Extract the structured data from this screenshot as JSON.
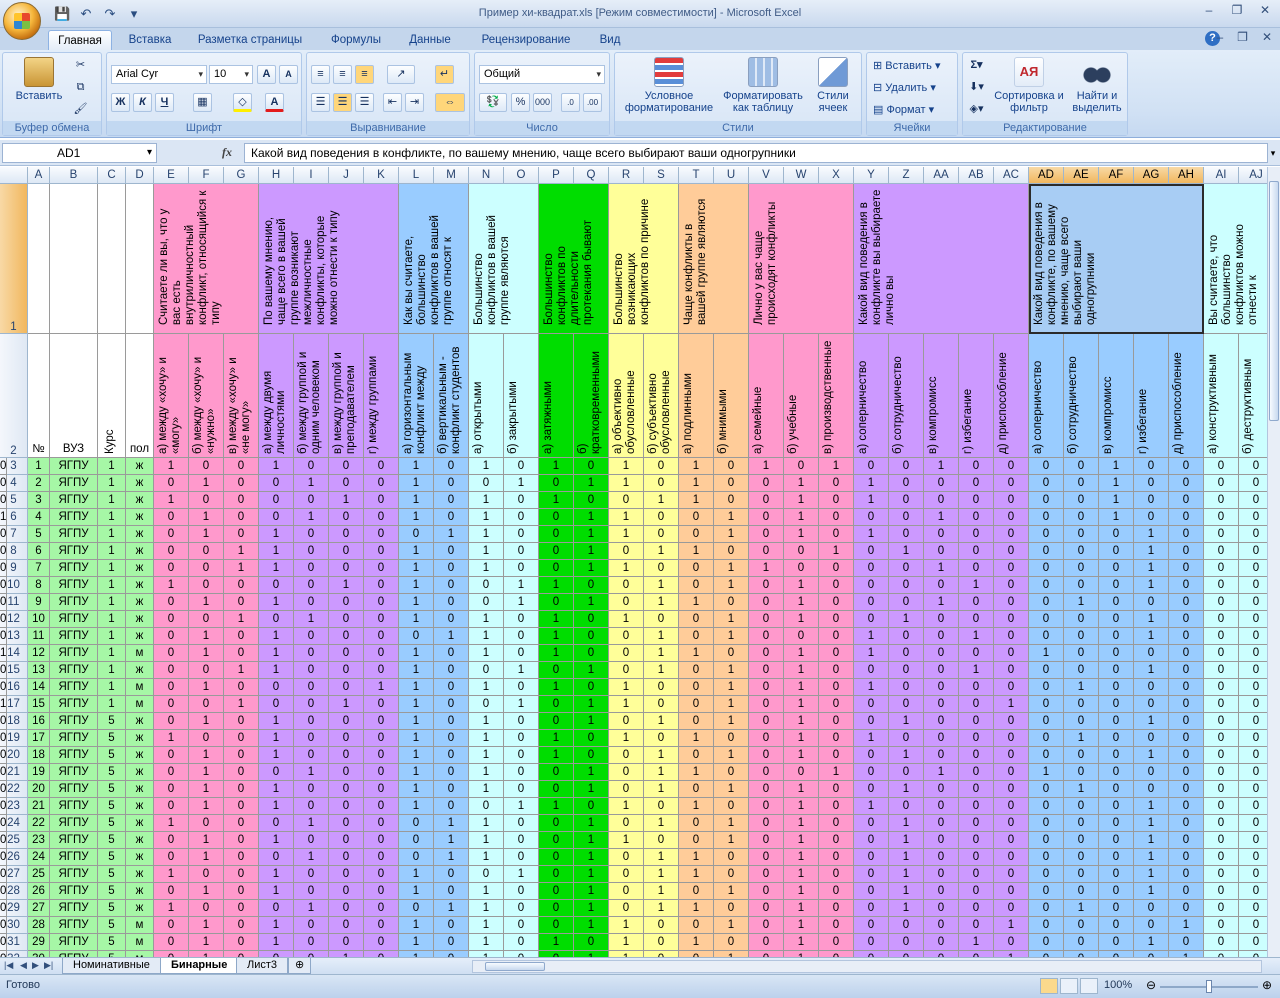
{
  "window": {
    "title": "Пример хи-квадрат.xls  [Режим совместимости] - Microsoft Excel"
  },
  "tabs": [
    "Главная",
    "Вставка",
    "Разметка страницы",
    "Формулы",
    "Данные",
    "Рецензирование",
    "Вид"
  ],
  "ribbon": {
    "clipboard": {
      "label": "Буфер обмена",
      "paste": "Вставить"
    },
    "font": {
      "label": "Шрифт",
      "name": "Arial Cyr",
      "size": "10"
    },
    "alignment": {
      "label": "Выравнивание"
    },
    "number": {
      "label": "Число",
      "format": "Общий"
    },
    "styles": {
      "label": "Стили",
      "cond": "Условное форматирование",
      "table": "Форматировать как таблицу",
      "cell": "Стили ячеек"
    },
    "cells": {
      "label": "Ячейки",
      "insert": "Вставить",
      "delete": "Удалить",
      "format": "Формат"
    },
    "editing": {
      "label": "Редактирование",
      "sort": "Сортировка и фильтр",
      "find": "Найти и выделить"
    }
  },
  "formula_bar": {
    "name_box": "AD1",
    "fx": "fx",
    "content": "Какой вид поведения в конфликте, по вашему мнению, чаще всего выбирают ваши одногрупники"
  },
  "columns": [
    "A",
    "B",
    "C",
    "D",
    "E",
    "F",
    "G",
    "H",
    "I",
    "J",
    "K",
    "L",
    "M",
    "N",
    "O",
    "P",
    "Q",
    "R",
    "S",
    "T",
    "U",
    "V",
    "W",
    "X",
    "Y",
    "Z",
    "AA",
    "AB",
    "AC",
    "AD",
    "AE",
    "AF",
    "AG",
    "AH",
    "AI",
    "AJ"
  ],
  "group_headers": [
    {
      "text": "Считаете ли вы, что у вас есть внутриличностный конфликт, относящийся к типу"
    },
    {
      "text": "По вашему мнению, чаще всего в вашей группе возникают межличностные конфликты, которые можно отнести к типу"
    },
    {
      "text": "Как вы считаете, большинство конфликтов в вашей группе относят к"
    },
    {
      "text": "Большинство конфликтов в вашей группе являются"
    },
    {
      "text": "Большинство конфликтов по длительности протекания бывают"
    },
    {
      "text": "Большинство возникающих конфликтов по причине"
    },
    {
      "text": "Чаще конфликты в вашей группе являются"
    },
    {
      "text": "Лично у вас чаще происходят конфликты"
    },
    {
      "text": "Какой вид поведения в конфликте вы выбираете лично вы"
    },
    {
      "text": "Какой вид поведения в конфликте, по вашему мнению, чаще всего выбирают ваши одногрупники"
    },
    {
      "text": "Вы считаете, что большинство конфликтов можно отнести к"
    }
  ],
  "subheaders_row2": {
    "A": "№",
    "B": "ВУЗ",
    "C": "Курс",
    "D": "пол",
    "E": "а) между «хочу» и «могу»",
    "F": "б) между «хочу» и «нужно»",
    "G": "в) между «хочу» и «не могу»",
    "H": "а) между двумя личностями",
    "I": "б) между группой и одним человеком",
    "J": "в) между группой и преподавателем",
    "K": "г) между группами",
    "L": "а) горизонтальным конфликт между",
    "M": "б) вертикальным - конфликт студентов",
    "N": "а) открытыми",
    "O": "б) закрытыми",
    "P": "а) затяжными",
    "Q": "б) кратковременными",
    "R": "а) объективно обусловленные",
    "S": "б) субъективно обусловленные",
    "T": "а) подлинными",
    "U": "б) мнимыми",
    "V": "а) семейные",
    "W": "б) учебные",
    "X": "в) производственные",
    "Y": "а) соперничество",
    "Z": "б) сотрудничество",
    "AA": "в) компромисс",
    "AB": "г) избегание",
    "AC": "д) приспособление",
    "AD": "а) соперничество",
    "AE": "б) сотрудничество",
    "AF": "в) компромисс",
    "AG": "г) избегание",
    "AH": "д) приспособление",
    "AI": "а) конструктивным",
    "AJ": "б) деструктивным"
  },
  "rows": [
    {
      "n": 1,
      "vuz": "ЯГПУ",
      "kurs": 1,
      "pol": "ж",
      "v": [
        1,
        0,
        0,
        1,
        0,
        0,
        0,
        1,
        0,
        1,
        0,
        1,
        0,
        1,
        0,
        1,
        0,
        1,
        0,
        1,
        0,
        0,
        1,
        0,
        0,
        0,
        0,
        1,
        0,
        0,
        0,
        0,
        1,
        0
      ]
    },
    {
      "n": 2,
      "vuz": "ЯГПУ",
      "kurs": 1,
      "pol": "ж",
      "v": [
        0,
        1,
        0,
        0,
        1,
        0,
        0,
        1,
        0,
        0,
        1,
        0,
        1,
        1,
        0,
        1,
        0,
        0,
        1,
        0,
        1,
        0,
        0,
        0,
        0,
        0,
        0,
        1,
        0,
        0,
        0,
        0,
        1,
        0
      ]
    },
    {
      "n": 3,
      "vuz": "ЯГПУ",
      "kurs": 1,
      "pol": "ж",
      "v": [
        1,
        0,
        0,
        0,
        0,
        1,
        0,
        1,
        0,
        1,
        0,
        1,
        0,
        0,
        1,
        1,
        0,
        0,
        1,
        0,
        1,
        0,
        0,
        0,
        0,
        0,
        0,
        1,
        0,
        0,
        0,
        0,
        1,
        0
      ]
    },
    {
      "n": 4,
      "vuz": "ЯГПУ",
      "kurs": 1,
      "pol": "ж",
      "v": [
        0,
        1,
        0,
        0,
        1,
        0,
        0,
        1,
        0,
        1,
        0,
        0,
        1,
        1,
        0,
        0,
        1,
        0,
        1,
        0,
        0,
        0,
        1,
        0,
        0,
        0,
        0,
        1,
        0,
        0,
        0,
        0,
        0,
        1
      ]
    },
    {
      "n": 5,
      "vuz": "ЯГПУ",
      "kurs": 1,
      "pol": "ж",
      "v": [
        0,
        1,
        0,
        1,
        0,
        0,
        0,
        0,
        1,
        1,
        0,
        0,
        1,
        1,
        0,
        0,
        1,
        0,
        1,
        0,
        1,
        0,
        0,
        0,
        0,
        0,
        0,
        0,
        1,
        0,
        0,
        0,
        1,
        0
      ]
    },
    {
      "n": 6,
      "vuz": "ЯГПУ",
      "kurs": 1,
      "pol": "ж",
      "v": [
        0,
        0,
        1,
        1,
        0,
        0,
        0,
        1,
        0,
        1,
        0,
        0,
        1,
        0,
        1,
        1,
        0,
        0,
        0,
        1,
        0,
        1,
        0,
        0,
        0,
        0,
        0,
        0,
        1,
        0,
        0,
        0,
        1,
        0
      ]
    },
    {
      "n": 7,
      "vuz": "ЯГПУ",
      "kurs": 1,
      "pol": "ж",
      "v": [
        0,
        0,
        1,
        1,
        0,
        0,
        0,
        1,
        0,
        1,
        0,
        0,
        1,
        1,
        0,
        0,
        1,
        1,
        0,
        0,
        0,
        0,
        1,
        0,
        0,
        0,
        0,
        0,
        1,
        0,
        0,
        0,
        1,
        0
      ]
    },
    {
      "n": 8,
      "vuz": "ЯГПУ",
      "kurs": 1,
      "pol": "ж",
      "v": [
        1,
        0,
        0,
        0,
        0,
        1,
        0,
        1,
        0,
        0,
        1,
        1,
        0,
        0,
        1,
        0,
        1,
        0,
        1,
        0,
        0,
        0,
        0,
        1,
        0,
        0,
        0,
        0,
        1,
        0,
        0,
        0,
        1,
        0
      ]
    },
    {
      "n": 9,
      "vuz": "ЯГПУ",
      "kurs": 1,
      "pol": "ж",
      "v": [
        0,
        1,
        0,
        1,
        0,
        0,
        0,
        1,
        0,
        0,
        1,
        0,
        1,
        0,
        1,
        1,
        0,
        0,
        1,
        0,
        0,
        0,
        1,
        0,
        0,
        0,
        1,
        0,
        0,
        0,
        0,
        0,
        1,
        0
      ]
    },
    {
      "n": 10,
      "vuz": "ЯГПУ",
      "kurs": 1,
      "pol": "ж",
      "v": [
        0,
        0,
        1,
        0,
        1,
        0,
        0,
        1,
        0,
        1,
        0,
        1,
        0,
        1,
        0,
        0,
        1,
        0,
        1,
        0,
        0,
        1,
        0,
        0,
        0,
        0,
        0,
        0,
        1,
        0,
        0,
        0,
        1,
        0
      ]
    },
    {
      "n": 11,
      "vuz": "ЯГПУ",
      "kurs": 1,
      "pol": "ж",
      "v": [
        0,
        1,
        0,
        1,
        0,
        0,
        0,
        0,
        1,
        1,
        0,
        1,
        0,
        0,
        1,
        0,
        1,
        0,
        0,
        0,
        1,
        0,
        0,
        1,
        0,
        0,
        0,
        0,
        1,
        0,
        0,
        0,
        1,
        0
      ]
    },
    {
      "n": 12,
      "vuz": "ЯГПУ",
      "kurs": 1,
      "pol": "м",
      "v": [
        0,
        1,
        0,
        1,
        0,
        0,
        0,
        1,
        0,
        1,
        0,
        1,
        0,
        0,
        1,
        1,
        0,
        0,
        1,
        0,
        1,
        0,
        0,
        0,
        0,
        1,
        0,
        0,
        0,
        0,
        0,
        0,
        0,
        1
      ]
    },
    {
      "n": 13,
      "vuz": "ЯГПУ",
      "kurs": 1,
      "pol": "ж",
      "v": [
        0,
        0,
        1,
        1,
        0,
        0,
        0,
        1,
        0,
        0,
        1,
        0,
        1,
        0,
        1,
        0,
        1,
        0,
        1,
        0,
        0,
        0,
        0,
        1,
        0,
        0,
        0,
        0,
        1,
        0,
        0,
        0,
        1,
        0
      ]
    },
    {
      "n": 14,
      "vuz": "ЯГПУ",
      "kurs": 1,
      "pol": "м",
      "v": [
        0,
        1,
        0,
        0,
        0,
        0,
        1,
        1,
        0,
        1,
        0,
        1,
        0,
        1,
        0,
        0,
        1,
        0,
        1,
        0,
        1,
        0,
        0,
        0,
        0,
        0,
        1,
        0,
        0,
        0,
        0,
        0,
        1,
        0
      ]
    },
    {
      "n": 15,
      "vuz": "ЯГПУ",
      "kurs": 1,
      "pol": "м",
      "v": [
        0,
        0,
        1,
        0,
        0,
        1,
        0,
        1,
        0,
        0,
        1,
        0,
        1,
        1,
        0,
        0,
        1,
        0,
        1,
        0,
        0,
        0,
        0,
        0,
        1,
        0,
        0,
        0,
        0,
        0,
        0,
        0,
        0,
        1
      ]
    },
    {
      "n": 16,
      "vuz": "ЯГПУ",
      "kurs": 5,
      "pol": "ж",
      "v": [
        0,
        1,
        0,
        1,
        0,
        0,
        0,
        1,
        0,
        1,
        0,
        0,
        1,
        0,
        1,
        0,
        1,
        0,
        1,
        0,
        0,
        1,
        0,
        0,
        0,
        0,
        0,
        0,
        1,
        0,
        0,
        0,
        1,
        0
      ]
    },
    {
      "n": 17,
      "vuz": "ЯГПУ",
      "kurs": 5,
      "pol": "ж",
      "v": [
        1,
        0,
        0,
        1,
        0,
        0,
        0,
        1,
        0,
        1,
        0,
        1,
        0,
        1,
        0,
        1,
        0,
        0,
        1,
        0,
        1,
        0,
        0,
        0,
        0,
        0,
        1,
        0,
        0,
        0,
        0,
        0,
        1,
        0
      ]
    },
    {
      "n": 18,
      "vuz": "ЯГПУ",
      "kurs": 5,
      "pol": "ж",
      "v": [
        0,
        1,
        0,
        1,
        0,
        0,
        0,
        1,
        0,
        1,
        0,
        1,
        0,
        0,
        1,
        0,
        1,
        0,
        1,
        0,
        0,
        1,
        0,
        0,
        0,
        0,
        0,
        0,
        1,
        0,
        0,
        0,
        1,
        0
      ]
    },
    {
      "n": 19,
      "vuz": "ЯГПУ",
      "kurs": 5,
      "pol": "ж",
      "v": [
        0,
        1,
        0,
        0,
        1,
        0,
        0,
        1,
        0,
        1,
        0,
        0,
        1,
        0,
        1,
        1,
        0,
        0,
        0,
        1,
        0,
        0,
        1,
        0,
        0,
        1,
        0,
        0,
        0,
        0,
        0,
        0,
        1,
        0
      ]
    },
    {
      "n": 20,
      "vuz": "ЯГПУ",
      "kurs": 5,
      "pol": "ж",
      "v": [
        0,
        1,
        0,
        1,
        0,
        0,
        0,
        1,
        0,
        1,
        0,
        0,
        1,
        0,
        1,
        0,
        1,
        0,
        1,
        0,
        0,
        1,
        0,
        0,
        0,
        0,
        1,
        0,
        0,
        0,
        0,
        0,
        1,
        0
      ]
    },
    {
      "n": 21,
      "vuz": "ЯГПУ",
      "kurs": 5,
      "pol": "ж",
      "v": [
        0,
        1,
        0,
        1,
        0,
        0,
        0,
        1,
        0,
        0,
        1,
        1,
        0,
        1,
        0,
        1,
        0,
        0,
        1,
        0,
        1,
        0,
        0,
        0,
        0,
        0,
        0,
        0,
        1,
        0,
        0,
        0,
        1,
        0
      ]
    },
    {
      "n": 22,
      "vuz": "ЯГПУ",
      "kurs": 5,
      "pol": "ж",
      "v": [
        1,
        0,
        0,
        0,
        1,
        0,
        0,
        0,
        1,
        1,
        0,
        0,
        1,
        0,
        1,
        0,
        1,
        0,
        1,
        0,
        0,
        1,
        0,
        0,
        0,
        0,
        0,
        0,
        1,
        0,
        0,
        0,
        1,
        0
      ]
    },
    {
      "n": 23,
      "vuz": "ЯГПУ",
      "kurs": 5,
      "pol": "ж",
      "v": [
        0,
        1,
        0,
        1,
        0,
        0,
        0,
        0,
        1,
        1,
        0,
        0,
        1,
        1,
        0,
        0,
        1,
        0,
        1,
        0,
        0,
        1,
        0,
        0,
        0,
        0,
        0,
        0,
        1,
        0,
        0,
        0,
        1,
        0
      ]
    },
    {
      "n": 24,
      "vuz": "ЯГПУ",
      "kurs": 5,
      "pol": "ж",
      "v": [
        0,
        1,
        0,
        0,
        1,
        0,
        0,
        0,
        1,
        1,
        0,
        0,
        1,
        0,
        1,
        1,
        0,
        0,
        1,
        0,
        0,
        1,
        0,
        0,
        0,
        0,
        0,
        0,
        1,
        0,
        0,
        0,
        1,
        0
      ]
    },
    {
      "n": 25,
      "vuz": "ЯГПУ",
      "kurs": 5,
      "pol": "ж",
      "v": [
        1,
        0,
        0,
        1,
        0,
        0,
        0,
        1,
        0,
        0,
        1,
        0,
        1,
        0,
        1,
        1,
        0,
        0,
        1,
        0,
        0,
        1,
        0,
        0,
        0,
        0,
        0,
        0,
        1,
        0,
        0,
        0,
        1,
        0
      ]
    },
    {
      "n": 26,
      "vuz": "ЯГПУ",
      "kurs": 5,
      "pol": "ж",
      "v": [
        0,
        1,
        0,
        1,
        0,
        0,
        0,
        1,
        0,
        1,
        0,
        0,
        1,
        0,
        1,
        0,
        1,
        0,
        1,
        0,
        0,
        1,
        0,
        0,
        0,
        0,
        0,
        0,
        1,
        0,
        0,
        0,
        1,
        0
      ]
    },
    {
      "n": 27,
      "vuz": "ЯГПУ",
      "kurs": 5,
      "pol": "ж",
      "v": [
        1,
        0,
        0,
        0,
        1,
        0,
        0,
        0,
        1,
        1,
        0,
        0,
        1,
        0,
        1,
        1,
        0,
        0,
        1,
        0,
        0,
        1,
        0,
        0,
        0,
        0,
        1,
        0,
        0,
        0,
        0,
        0,
        1,
        0
      ]
    },
    {
      "n": 28,
      "vuz": "ЯГПУ",
      "kurs": 5,
      "pol": "м",
      "v": [
        0,
        1,
        0,
        1,
        0,
        0,
        0,
        1,
        0,
        1,
        0,
        0,
        1,
        1,
        0,
        0,
        1,
        0,
        1,
        0,
        0,
        0,
        0,
        0,
        1,
        0,
        0,
        0,
        0,
        1,
        0,
        0,
        1,
        0
      ]
    },
    {
      "n": 29,
      "vuz": "ЯГПУ",
      "kurs": 5,
      "pol": "м",
      "v": [
        0,
        1,
        0,
        1,
        0,
        0,
        0,
        1,
        0,
        1,
        0,
        1,
        0,
        1,
        0,
        1,
        0,
        0,
        1,
        0,
        0,
        0,
        0,
        1,
        0,
        0,
        0,
        0,
        1,
        0,
        0,
        0,
        1,
        0
      ]
    },
    {
      "n": 30,
      "vuz": "ЯГПУ",
      "kurs": 5,
      "pol": "м",
      "v": [
        0,
        1,
        0,
        0,
        0,
        1,
        0,
        1,
        0,
        1,
        0,
        0,
        1,
        1,
        0,
        0,
        1,
        0,
        1,
        0,
        0,
        0,
        0,
        0,
        1,
        0,
        0,
        0,
        0,
        1,
        0,
        0,
        1,
        0
      ]
    }
  ],
  "sheets": [
    "Номинативные",
    "Бинарные",
    "Лист3"
  ],
  "active_sheet": "Бинарные",
  "status": {
    "ready": "Готово",
    "zoom": "100%"
  }
}
